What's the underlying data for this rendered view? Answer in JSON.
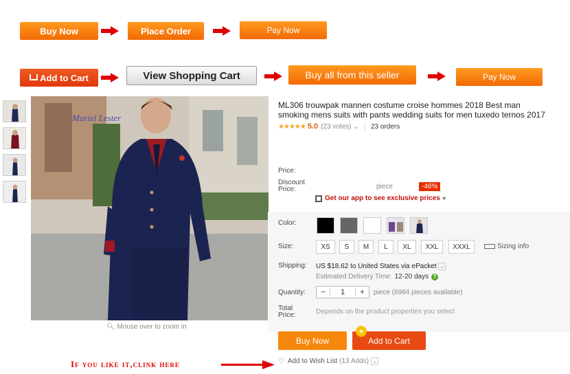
{
  "steps": {
    "row1": {
      "buy_now": "Buy Now",
      "place_order": "Place Order",
      "pay_now": "Pay Now"
    },
    "row2": {
      "add_to_cart": "Add to Cart",
      "view_cart": "View Shopping Cart",
      "buy_all": "Buy all from this seller",
      "pay_now": "Pay Now"
    }
  },
  "gallery": {
    "watermark": "Muriel Lester",
    "zoom_hint": "Mouse over to zoom in",
    "thumbnail_count": 4
  },
  "product": {
    "title": "ML306 trouwpak mannen costume croise hommes 2018 Best man smoking mens suits with pants wedding suits for men tuxedo ternos 2017",
    "rating_stars": 5,
    "rating_value": "5.0",
    "votes": "(23 votes)",
    "orders": "23 orders"
  },
  "pricing": {
    "price_label": "Price:",
    "discount_label": "Discount Price:",
    "unit": "piece",
    "discount_badge": "-46%",
    "app_promo": "Get our app to see exclusive prices"
  },
  "options": {
    "color_label": "Color:",
    "colors": [
      "#000000",
      "#666666",
      "#ffffff"
    ],
    "size_label": "Size:",
    "sizes": [
      "XS",
      "S",
      "M",
      "L",
      "XL",
      "XXL",
      "XXXL"
    ],
    "size_info": "Sizing info",
    "shipping_label": "Shipping:",
    "shipping_text": "US $18.62 to United States via ePacket",
    "delivery_label": "Estimated Delivery Time:",
    "delivery_value": "12-20 days",
    "quantity_label": "Quantity:",
    "quantity": "1",
    "quantity_note": "piece (6984 pieces available)",
    "total_label": "Total Price:",
    "total_note": "Depends on the product properties you select"
  },
  "actions": {
    "buy_now": "Buy Now",
    "add_to_cart": "Add to Cart",
    "wish_list": "Add to Wish List",
    "wish_count": "(13 Adds)"
  },
  "callout": "If you like it,clink here",
  "colors": {
    "accent_orange": "#f5880c",
    "accent_red": "#e84a12",
    "badge_red": "#e62e04",
    "callout_red": "#e00000"
  }
}
